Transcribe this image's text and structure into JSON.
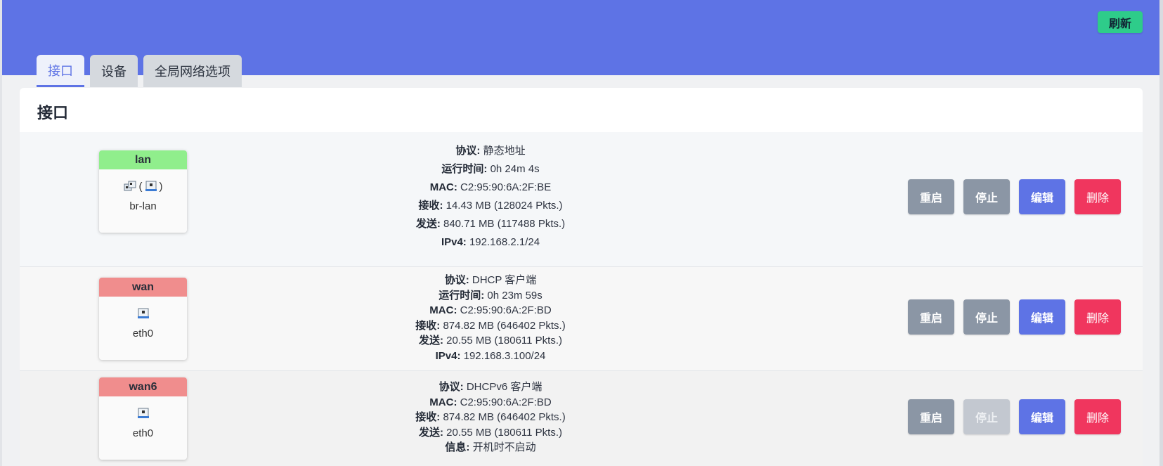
{
  "header": {
    "refresh_label": "刷新"
  },
  "tabs": [
    {
      "label": "接口",
      "active": true
    },
    {
      "label": "设备",
      "active": false
    },
    {
      "label": "全局网络选项",
      "active": false
    }
  ],
  "panel": {
    "title": "接口"
  },
  "colors": {
    "accent": "#5e73e5",
    "refresh": "#2ecc8a",
    "delete": "#f0365e",
    "lan_head": "#90ee8c",
    "wan_head": "#f08d8d"
  },
  "interfaces": [
    {
      "name": "lan",
      "device_prefix": "(",
      "device_suffix": ")",
      "device": "br-lan",
      "info": [
        {
          "k": "协议:",
          "v": "静态地址"
        },
        {
          "k": "运行时间:",
          "v": "0h 24m 4s"
        },
        {
          "k": "MAC:",
          "v": "C2:95:90:6A:2F:BE"
        },
        {
          "k": "接收:",
          "v": "14.43 MB (128024 Pkts.)"
        },
        {
          "k": "发送:",
          "v": "840.71 MB (117488 Pkts.)"
        },
        {
          "k": "IPv4:",
          "v": "192.168.2.1/24"
        }
      ],
      "actions": {
        "restart": "重启",
        "stop": "停止",
        "edit": "编辑",
        "delete": "删除"
      }
    },
    {
      "name": "wan",
      "device": "eth0",
      "info": [
        {
          "k": "协议:",
          "v": "DHCP 客户端"
        },
        {
          "k": "运行时间:",
          "v": "0h 23m 59s"
        },
        {
          "k": "MAC:",
          "v": "C2:95:90:6A:2F:BD"
        },
        {
          "k": "接收:",
          "v": "874.82 MB (646402 Pkts.)"
        },
        {
          "k": "发送:",
          "v": "20.55 MB (180611 Pkts.)"
        },
        {
          "k": "IPv4:",
          "v": "192.168.3.100/24"
        }
      ],
      "actions": {
        "restart": "重启",
        "stop": "停止",
        "edit": "编辑",
        "delete": "删除"
      }
    },
    {
      "name": "wan6",
      "device": "eth0",
      "info": [
        {
          "k": "协议:",
          "v": "DHCPv6 客户端"
        },
        {
          "k": "MAC:",
          "v": "C2:95:90:6A:2F:BD"
        },
        {
          "k": "接收:",
          "v": "874.82 MB (646402 Pkts.)"
        },
        {
          "k": "发送:",
          "v": "20.55 MB (180611 Pkts.)"
        },
        {
          "k": "信息:",
          "v": "开机时不启动"
        }
      ],
      "actions": {
        "restart": "重启",
        "stop": "停止",
        "edit": "编辑",
        "delete": "删除"
      }
    }
  ]
}
